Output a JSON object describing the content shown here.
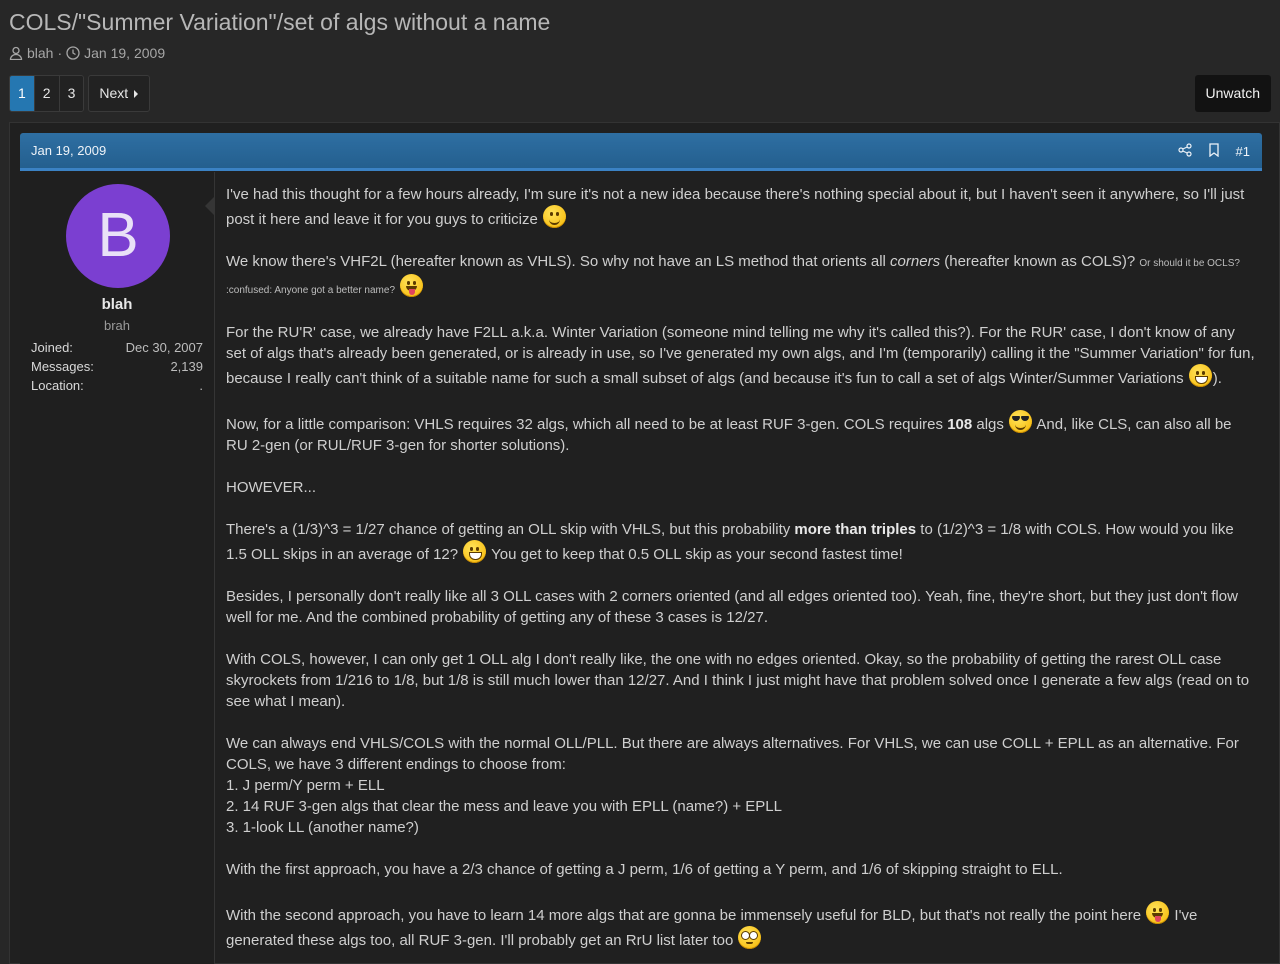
{
  "thread": {
    "title": "COLS/\"Summer Variation\"/set of algs without a name",
    "author": "blah",
    "separator": "·",
    "date": "Jan 19, 2009"
  },
  "pagination": {
    "pages": [
      "1",
      "2",
      "3"
    ],
    "current": "1",
    "next_label": "Next"
  },
  "unwatch_label": "Unwatch",
  "post": {
    "date": "Jan 19, 2009",
    "number": "#1",
    "user": {
      "avatar_letter": "B",
      "avatar_color": "#7b3fd1",
      "name": "blah",
      "title": "brah",
      "stats": [
        {
          "label": "Joined:",
          "value": "Dec 30, 2007"
        },
        {
          "label": "Messages:",
          "value": "2,139"
        },
        {
          "label": "Location:",
          "value": "."
        }
      ]
    },
    "body": {
      "p1": "I've had this thought for a few hours already, I'm sure it's not a new idea because there's nothing special about it, but I haven't seen it anywhere, so I'll just post it here and leave it for you guys to criticize",
      "p2a": "We know there's VHF2L (hereafter known as VHLS). So why not have an LS method that orients all ",
      "p2_em": "corners",
      "p2b": " (hereafter known as COLS)? ",
      "p2_small": "Or should it be OCLS? :confused: Anyone got a better name?",
      "p3a": "For the RU'R' case, we already have F2LL a.k.a. Winter Variation (someone mind telling me why it's called this?). For the RUR' case, I don't know of any set of algs that's already been generated, or is already in use, so I've generated my own algs, and I'm (temporarily) calling it the \"Summer Variation\" for fun, because I really can't think of a suitable name for such a small subset of algs (and because it's fun to call a set of algs Winter/Summer Variations",
      "p3b": ").",
      "p4a": "Now, for a little comparison: VHLS requires 32 algs, which all need to be at least RUF 3-gen. COLS requires ",
      "p4_b": "108",
      "p4b": " algs",
      "p4c": " And, like CLS, can also all be RU 2-gen (or RUL/RUF 3-gen for shorter solutions).",
      "p5": "HOWEVER...",
      "p6a": "There's a (1/3)^3 = 1/27 chance of getting an OLL skip with VHLS, but this probability ",
      "p6_b": "more than triples",
      "p6b": " to (1/2)^3 = 1/8 with COLS. How would you like 1.5 OLL skips in an average of 12?",
      "p6c": " You get to keep that 0.5 OLL skip as your second fastest time!",
      "p7": "Besides, I personally don't really like all 3 OLL cases with 2 corners oriented (and all edges oriented too). Yeah, fine, they're short, but they just don't flow well for me. And the combined probability of getting any of these 3 cases is 12/27.",
      "p8": "With COLS, however, I can only get 1 OLL alg I don't really like, the one with no edges oriented. Okay, so the probability of getting the rarest OLL case skyrockets from 1/216 to 1/8, but 1/8 is still much lower than 12/27. And I think I just might have that problem solved once I generate a few algs (read on to see what I mean).",
      "p9_intro": "We can always end VHLS/COLS with the normal OLL/PLL. But there are always alternatives. For VHLS, we can use COLL + EPLL as an alternative. For COLS, we have 3 different endings to choose from:",
      "p9_list": [
        "1. J perm/Y perm + ELL",
        "2. 14 RUF 3-gen algs that clear the mess and leave you with EPLL (name?) + EPLL",
        "3. 1-look LL (another name?)"
      ],
      "p10": "With the first approach, you have a 2/3 chance of getting a J perm, 1/6 of getting a Y perm, and 1/6 of skipping straight to ELL.",
      "p11a": "With the second approach, you have to learn 14 more algs that are gonna be immensely useful for BLD, but that's not really the point here",
      "p11b": " I've generated these algs too, all RUF 3-gen. I'll probably get an RrU list later too"
    }
  },
  "colors": {
    "background": "#272727",
    "accent": "#2577b1",
    "header": "#2e6fa3"
  },
  "icons": [
    "user-icon",
    "clock-icon",
    "chevron-right-icon",
    "share-icon",
    "bookmark-icon",
    "smile-emoji",
    "tongue-emoji",
    "grin-emoji",
    "cool-emoji",
    "rolleyes-emoji"
  ]
}
